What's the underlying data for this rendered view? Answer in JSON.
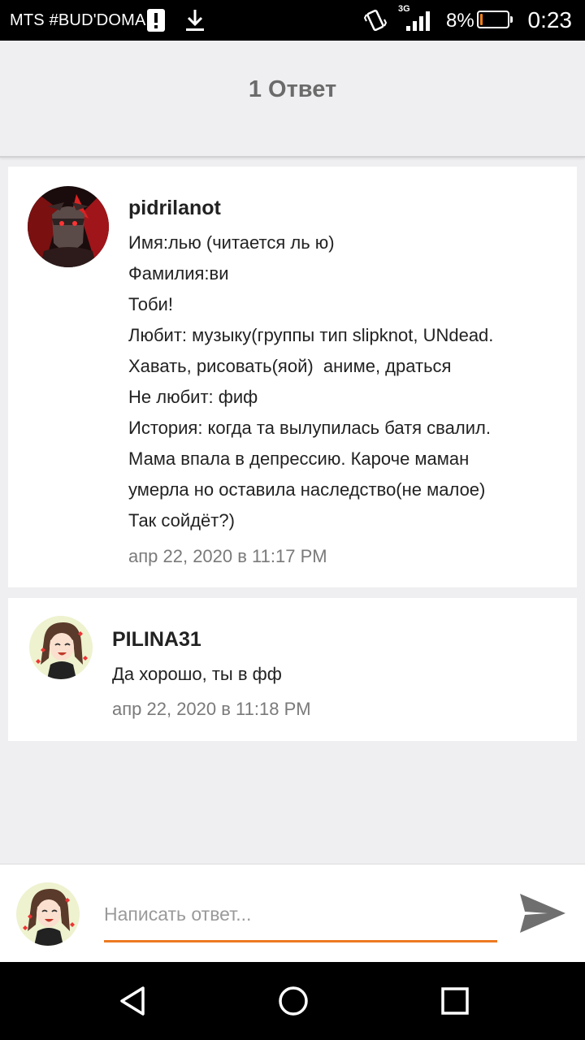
{
  "status_bar": {
    "carrier": "MTS #BUD'DOMA",
    "network_type": "3G",
    "battery_percent": "8%",
    "battery_level": 0.08,
    "time": "0:23",
    "icons": [
      "alert-icon",
      "download-icon",
      "vibrate-icon",
      "signal-icon",
      "battery-icon"
    ]
  },
  "header": {
    "title": "1 Ответ"
  },
  "comments": [
    {
      "username": "pidrilanot",
      "lines": [
        "Имя:лью (читается ль ю)",
        "Фамилия:ви",
        "Тоби!",
        "Любит: музыку(группы тип slipknot, UNdead.",
        "Хавать, рисовать(яой)  аниме, драться",
        "Не любит: фиф",
        "История: когда та вылупилась батя свалил.",
        "Мама впала в депрессию. Кароче маман",
        "умерла но оставила наследство(не малое)",
        "Так сойдёт?)"
      ],
      "timestamp": "апр 22, 2020 в 11:17 PM"
    },
    {
      "username": "PILINA31",
      "lines": [
        "Да хорошо, ты в фф"
      ],
      "timestamp": "апр 22, 2020 в 11:18 PM"
    }
  ],
  "reply": {
    "placeholder": "Написать ответ...",
    "value": ""
  },
  "colors": {
    "accent": "#ec7a22",
    "background": "#efeef0",
    "battery_low": "#f07f1a"
  },
  "nav": [
    "back-icon",
    "home-icon",
    "recents-icon"
  ]
}
